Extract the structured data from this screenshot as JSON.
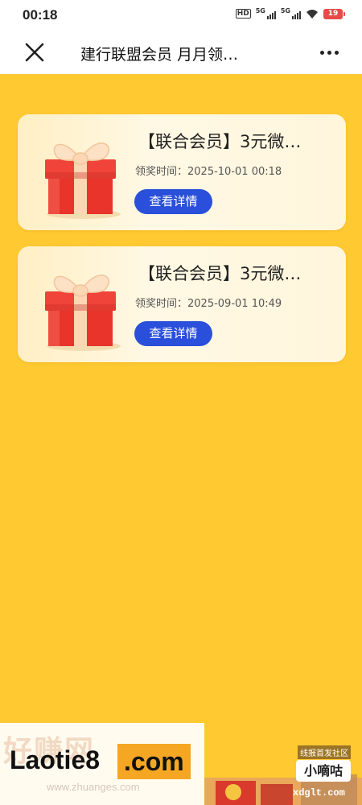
{
  "status_bar": {
    "time": "00:18",
    "hd_label": "HD",
    "net1_label": "5G",
    "net2_label": "5G",
    "battery": "19"
  },
  "nav": {
    "title": "建行联盟会员 月月领…",
    "close_icon": "close-icon",
    "more_icon": "more-dots-icon"
  },
  "records": [
    {
      "title": "【联合会员】3元微…",
      "time_label": "领奖时间：",
      "time_value": "2025-10-01 00:18",
      "button_label": "查看详情"
    },
    {
      "title": "【联合会员】3元微…",
      "time_label": "领奖时间：",
      "time_value": "2025-09-01 10:49",
      "button_label": "查看详情"
    }
  ],
  "watermark": {
    "brand": "Laotie8",
    "brand_suffix": ".com",
    "ghost_text": "好赚网",
    "ghost_url": "www.zhuanges.com",
    "site_tag": "线报首发社区",
    "site_name": "小嘀咕",
    "site_url": "xdglt.com"
  },
  "colors": {
    "background": "#FFC931",
    "button": "#2A4FDB",
    "gift_red": "#E8342A",
    "ribbon": "#FBD7B4"
  }
}
